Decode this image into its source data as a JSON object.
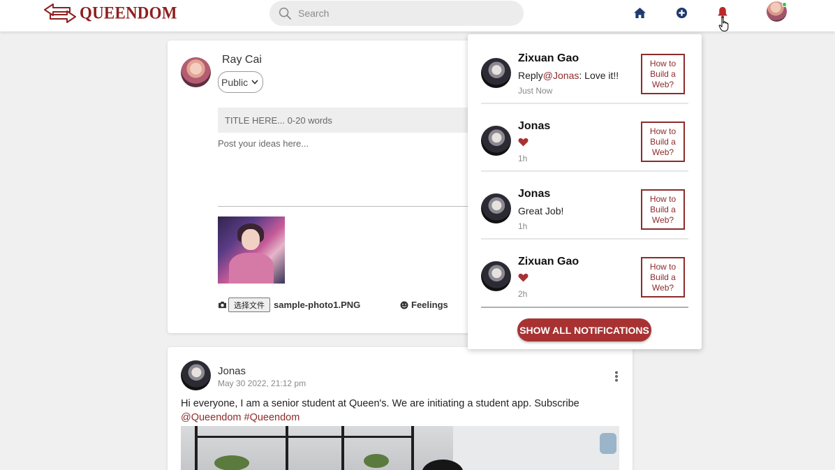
{
  "app": {
    "logo_text": "QUEENDOM"
  },
  "header": {
    "search_placeholder": "Search",
    "icons": [
      "home-icon",
      "add-circle-icon",
      "bell-icon",
      "user-avatar"
    ]
  },
  "composer": {
    "user_name": "Ray Cai",
    "privacy_value": "Public",
    "title_placeholder": "TITLE HERE... 0-20 words",
    "body_placeholder": "Post your ideas here...",
    "file_button": "选择文件",
    "file_name": "sample-photo1.PNG",
    "feelings_label": "Feelings"
  },
  "post": {
    "author": "Jonas",
    "date": "May 30 2022, 21:12 pm",
    "text": "Hi everyone, I am a senior student at Queen's. We are initiating a student app. Subscribe",
    "tag_mention": "@Queendom",
    "tag_hash": "#Queendom"
  },
  "notifications": {
    "items": [
      {
        "name": "Zixuan Gao",
        "text_prefix": "Reply",
        "mention": "@Jonas",
        "text_suffix": ": Love it!!",
        "time": "Just Now",
        "post": "How to Build a Web?",
        "type": "reply"
      },
      {
        "name": "Jonas",
        "time": "1h",
        "post": "How to Build a Web?",
        "type": "like"
      },
      {
        "name": "Jonas",
        "text": "Great Job!",
        "time": "1h",
        "post": "How to Build a Web?",
        "type": "comment"
      },
      {
        "name": "Zixuan Gao",
        "time": "2h",
        "post": "How to Build a Web?",
        "type": "like"
      }
    ],
    "show_all_label": "SHOW ALL NOTIFICATIONS"
  },
  "colors": {
    "brand": "#8e1f1f",
    "accent": "#a83232",
    "heart": "#a83232",
    "nav_icon": "#1f3a6e",
    "bell": "#b82a2a"
  }
}
